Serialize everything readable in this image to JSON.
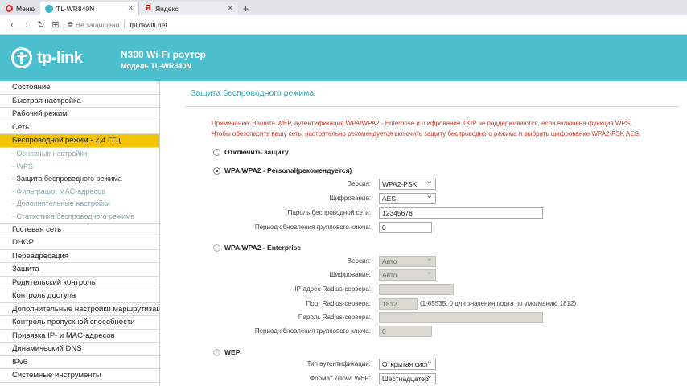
{
  "browser": {
    "menu_label": "Меню",
    "tab_active_title": "TL-WR840N",
    "tab_inactive_title": "Яндекс",
    "security_text": "Не защищено",
    "url": "tplinkwifi.net",
    "close_glyph": "✕",
    "newtab_glyph": "+"
  },
  "header": {
    "logo_text": "tp-link",
    "model_title": "N300 Wi-Fi роутер",
    "model_sub": "Модель TL-WR840N"
  },
  "sidebar": {
    "items_top": [
      "Состояние",
      "Быстрая настройка",
      "Рабочий режим",
      "Сеть"
    ],
    "active": "Беспроводной режим - 2,4 ГГц",
    "subitems": [
      "- Основные настройки",
      "- WPS",
      "- Защита беспроводного режима",
      "- Фильтрация MAC-адресов",
      "- Дополнительные настройки",
      "- Статистика беспроводного режима"
    ],
    "items_bottom": [
      "Гостевая сеть",
      "DHCP",
      "Переадресация",
      "Защита",
      "Родительский контроль",
      "Контроль доступа",
      "Дополнительные настройки маршрутизации",
      "Контроль пропускной способности",
      "Привязка IP- и MAC-адресов",
      "Динамический DNS",
      "IPv6",
      "Системные инструменты"
    ]
  },
  "main": {
    "title": "Защита беспроводного режима",
    "note1": "Примечание: Защита WEP, аутентификация WPA/WPA2 - Enterprise и шифрование TKIP не поддерживаются, если включена функция WPS.",
    "note2": "Чтобы обезопасить вашу сеть, настоятельно рекомендуется включить защиту беспроводного режима и выбрать шифрование WPA2-PSK AES.",
    "opt_disable": "Отключить защиту",
    "opt_personal": "WPA/WPA2 - Personal(рекомендуется)",
    "personal": {
      "version_label": "Версия:",
      "version_value": "WPA2-PSK",
      "enc_label": "Шифрование:",
      "enc_value": "AES",
      "pass_label": "Пароль беспроводной сети:",
      "pass_value": "12345678",
      "period_label": "Период обновления группового ключа:",
      "period_value": "0"
    },
    "opt_enterprise": "WPA/WPA2 - Enterprise",
    "enterprise": {
      "version_label": "Версия:",
      "version_value": "Авто",
      "enc_label": "Шифрование:",
      "enc_value": "Авто",
      "ip_label": "IP-адрес Radius-сервера:",
      "ip_value": "",
      "port_label": "Порт Radius-сервера:",
      "port_value": "1812",
      "port_hint": "(1-65535, 0 для значения порта по умолчанию 1812)",
      "pass_label": "Пароль Radius-сервера:",
      "pass_value": "",
      "period_label": "Период обновления группового ключа:",
      "period_value": "0"
    },
    "opt_wep": "WEP",
    "wep": {
      "auth_label": "Тип аутентификации:",
      "auth_value": "Открытая сист",
      "format_label": "Формат ключа WEP:",
      "format_value": "Шестнадцатер"
    }
  }
}
